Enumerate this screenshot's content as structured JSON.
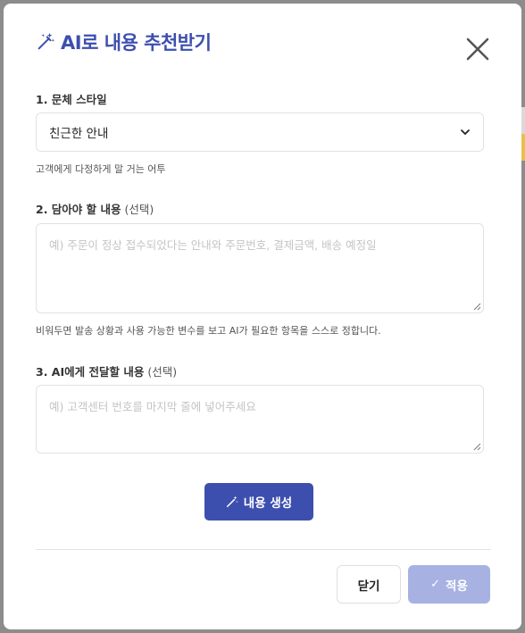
{
  "modal": {
    "title": "AI로 내용 추천받기",
    "title_icon": "magic-wand-icon",
    "close_icon": "close-icon"
  },
  "style_field": {
    "label": "1. 문체 스타일",
    "selected": "친근한 안내",
    "help": "고객에게 다정하게 말 거는 어투"
  },
  "content_field": {
    "label": "2. 담아야 할 내용",
    "optional": "(선택)",
    "placeholder": "예) 주문이 정상 접수되었다는 안내와 주문번호, 결제금액, 배송 예정일",
    "help": "비워두면 발송 상황과 사용 가능한 변수를 보고 AI가 필요한 항목을 스스로 정합니다."
  },
  "message_field": {
    "label": "3. AI에게 전달할 내용",
    "optional": "(선택)",
    "placeholder": "예) 고객센터 번호를 마지막 줄에 넣어주세요"
  },
  "actions": {
    "generate": "내용 생성",
    "close": "닫기",
    "apply": "적용"
  },
  "colors": {
    "accent": "#3d4fae",
    "apply_disabled": "#a7b2e3"
  }
}
